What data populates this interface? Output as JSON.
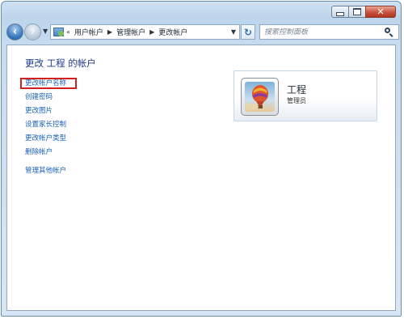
{
  "window": {
    "controls": {
      "minimize": "",
      "maximize": "",
      "close": ""
    }
  },
  "navigation": {
    "breadcrumbs": [
      "用户帐户",
      "管理帐户",
      "更改帐户"
    ],
    "search_placeholder": "搜索控制面板"
  },
  "main": {
    "title": "更改 工程 的帐户",
    "tasks": [
      "更改帐户名称",
      "创建密码",
      "更改图片",
      "设置家长控制",
      "更改帐户类型",
      "删除帐户",
      "管理其他帐户"
    ],
    "highlighted_task_index": 0,
    "account": {
      "name": "工程",
      "role": "管理员"
    }
  },
  "colors": {
    "link": "#1a5fb8",
    "title": "#1e3a8a",
    "highlight_box": "#d21f1f",
    "close_button": "#c8523f"
  },
  "icons": {
    "back": "back-arrow-icon",
    "forward": "forward-arrow-icon",
    "address": "control-panel-icon",
    "refresh": "refresh-icon",
    "search": "search-icon",
    "avatar": "hot-air-balloon-picture"
  }
}
